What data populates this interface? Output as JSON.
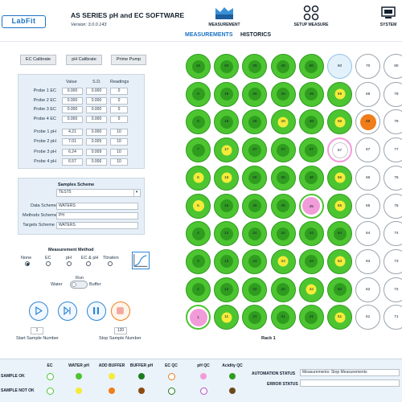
{
  "header": {
    "logo": "LabFit",
    "title": "AS SERIES pH and EC SOFTWARE",
    "version": "Version: 3.0.0.143",
    "nav": [
      {
        "label": "MEASUREMENT",
        "icon": "measurement-icon"
      },
      {
        "label": "SETUP MEASURE",
        "icon": "setup-icon"
      },
      {
        "label": "SYSTEM",
        "icon": "system-icon"
      }
    ],
    "tabs": [
      "MEASUREMENTS",
      "HISTORICS"
    ]
  },
  "calibration": {
    "ec_button": "EC Calibrate",
    "ph_button": "pH Calibrate",
    "prime_button": "Prime Pump"
  },
  "probes": {
    "headers": [
      "Value",
      "S.D.",
      "Readings"
    ],
    "ec": [
      {
        "label": "Probe 1 EC",
        "value": "0.000",
        "sd": "0.000",
        "readings": "0"
      },
      {
        "label": "Probe 2 EC",
        "value": "0.000",
        "sd": "0.000",
        "readings": "0"
      },
      {
        "label": "Probe 3 EC",
        "value": "0.000",
        "sd": "0.000",
        "readings": "0"
      },
      {
        "label": "Probe 4 EC",
        "value": "0.000",
        "sd": "0.000",
        "readings": "0"
      }
    ],
    "ph": [
      {
        "label": "Probe 1 pH",
        "value": "4.21",
        "sd": "0.000",
        "readings": "10"
      },
      {
        "label": "Probe 2 pH",
        "value": "7.01",
        "sd": "0.005",
        "readings": "10"
      },
      {
        "label": "Probe 3 pH",
        "value": "6.24",
        "sd": "0.009",
        "readings": "10"
      },
      {
        "label": "Probe 4 pH",
        "value": "6.57",
        "sd": "0.006",
        "readings": "10"
      }
    ]
  },
  "scheme": {
    "title": "Samples Scheme",
    "selected": "TEST5",
    "rows": [
      {
        "label": "Data Scheme",
        "value": "WATERS"
      },
      {
        "label": "Methods Scheme",
        "value": "PH"
      },
      {
        "label": "Targets Scheme",
        "value": "WATERS"
      }
    ]
  },
  "method": {
    "title": "Measurement Method",
    "options": [
      "None",
      "EC",
      "pH",
      "EC & pH",
      "Titration"
    ],
    "selected": "None"
  },
  "run": {
    "label": "Run",
    "left": "Water",
    "right": "Buffer"
  },
  "samples": {
    "start_value": "1",
    "start_label": "Start Sample Number",
    "stop_value": "120",
    "stop_label": "Stop Sample Number"
  },
  "rack": {
    "label": "Rack 1",
    "colors": {
      "green": "#4cc531",
      "green_dark": "#2f9c1f",
      "yellow": "#f5eb3a",
      "orange": "#f07d1a",
      "pink": "#f29bd9",
      "purple": "#b44fc9",
      "empty": "#ffffff"
    },
    "wells": [
      {
        "n": "1",
        "s": "pink_ring"
      },
      {
        "n": "2",
        "s": "green"
      },
      {
        "n": "3",
        "s": "green"
      },
      {
        "n": "4",
        "s": "green"
      },
      {
        "n": "5",
        "s": "yellow_small"
      },
      {
        "n": "6",
        "s": "green_yellow"
      },
      {
        "n": "7",
        "s": "green"
      },
      {
        "n": "8",
        "s": "green"
      },
      {
        "n": "9",
        "s": "green"
      },
      {
        "n": "10",
        "s": "green"
      },
      {
        "n": "11",
        "s": "green_yellow"
      },
      {
        "n": "12",
        "s": "green"
      },
      {
        "n": "13",
        "s": "green"
      },
      {
        "n": "14",
        "s": "green"
      },
      {
        "n": "15",
        "s": "green"
      },
      {
        "n": "16",
        "s": "green_yellow"
      },
      {
        "n": "17",
        "s": "green_yellow"
      },
      {
        "n": "18",
        "s": "green"
      },
      {
        "n": "19",
        "s": "green"
      },
      {
        "n": "20",
        "s": "green"
      },
      {
        "n": "21",
        "s": "green"
      },
      {
        "n": "22",
        "s": "green"
      },
      {
        "n": "23",
        "s": "green"
      },
      {
        "n": "24",
        "s": "green"
      },
      {
        "n": "25",
        "s": "green"
      },
      {
        "n": "26",
        "s": "green"
      },
      {
        "n": "27",
        "s": "green"
      },
      {
        "n": "28",
        "s": "green"
      },
      {
        "n": "29",
        "s": "green"
      },
      {
        "n": "30",
        "s": "green"
      },
      {
        "n": "31",
        "s": "green"
      },
      {
        "n": "32",
        "s": "green"
      },
      {
        "n": "33",
        "s": "green_yellow"
      },
      {
        "n": "34",
        "s": "green"
      },
      {
        "n": "35",
        "s": "green"
      },
      {
        "n": "36",
        "s": "green"
      },
      {
        "n": "37",
        "s": "green"
      },
      {
        "n": "38",
        "s": "green_yellow"
      },
      {
        "n": "39",
        "s": "green"
      },
      {
        "n": "40",
        "s": "green"
      },
      {
        "n": "41",
        "s": "green"
      },
      {
        "n": "42",
        "s": "green_yellow"
      },
      {
        "n": "43",
        "s": "green"
      },
      {
        "n": "44",
        "s": "green"
      },
      {
        "n": "45",
        "s": "pink_ring"
      },
      {
        "n": "46",
        "s": "green"
      },
      {
        "n": "47",
        "s": "green"
      },
      {
        "n": "48",
        "s": "green"
      },
      {
        "n": "49",
        "s": "green"
      },
      {
        "n": "50",
        "s": "green"
      },
      {
        "n": "51",
        "s": "green_yellow"
      },
      {
        "n": "52",
        "s": "green"
      },
      {
        "n": "53",
        "s": "green_yellow"
      },
      {
        "n": "54",
        "s": "green"
      },
      {
        "n": "55",
        "s": "green_yellow"
      },
      {
        "n": "56",
        "s": "green_yellow"
      },
      {
        "n": "57",
        "s": "white_pink"
      },
      {
        "n": "58",
        "s": "green_yellow"
      },
      {
        "n": "59",
        "s": "green_yellow"
      },
      {
        "n": "60",
        "s": "light_blue"
      },
      {
        "n": "61",
        "s": "empty"
      },
      {
        "n": "62",
        "s": "empty"
      },
      {
        "n": "63",
        "s": "empty"
      },
      {
        "n": "64",
        "s": "empty"
      },
      {
        "n": "65",
        "s": "empty"
      },
      {
        "n": "66",
        "s": "empty"
      },
      {
        "n": "67",
        "s": "empty"
      },
      {
        "n": "68",
        "s": "orange"
      },
      {
        "n": "69",
        "s": "empty"
      },
      {
        "n": "70",
        "s": "empty"
      },
      {
        "n": "71",
        "s": "empty"
      },
      {
        "n": "72",
        "s": "empty"
      },
      {
        "n": "73",
        "s": "empty"
      },
      {
        "n": "74",
        "s": "empty"
      },
      {
        "n": "75",
        "s": "empty"
      },
      {
        "n": "76",
        "s": "empty"
      },
      {
        "n": "77",
        "s": "empty"
      },
      {
        "n": "78",
        "s": "empty"
      },
      {
        "n": "79",
        "s": "empty"
      },
      {
        "n": "80",
        "s": "empty"
      }
    ]
  },
  "legend": {
    "headers": [
      "EC",
      "WATER pH",
      "ADD BUFFER",
      "BUFFER pH",
      "EC QC",
      "pH QC",
      "Acidity QC"
    ],
    "row_ok": "SAMPLE OK",
    "row_not_ok": "SAMPLE NOT OK",
    "ok_colors": [
      "#ffffff",
      "#4cc531",
      "#f5eb3a",
      "#1c7a1c",
      "#f07d1a",
      "#f29bd9",
      "#2f9c1f"
    ],
    "not_ok_colors": [
      "#4cc531",
      "#f5eb3a",
      "#f07d1a",
      "#8a4b12",
      "#1c7a1c",
      "#b44fc9",
      "#6b4a1a"
    ],
    "automation_label": "AUTOMATION STATUS",
    "automation_value": "Measurements: Stop Measurements",
    "error_label": "ERROR STATUS",
    "error_value": ""
  }
}
